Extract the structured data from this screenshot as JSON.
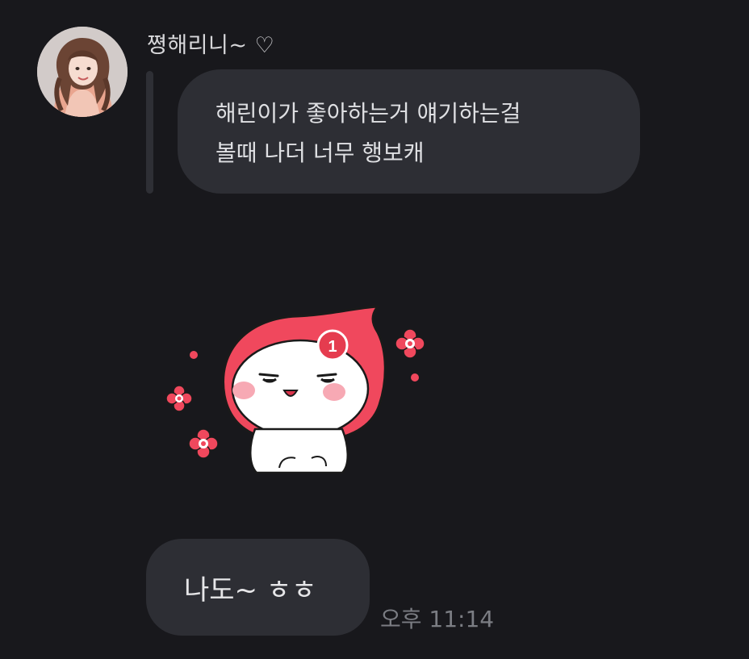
{
  "message_group": {
    "sender_name": "쪙해리니~ ♡",
    "avatar_icon": "profile-photo",
    "replied_message": {
      "lines": [
        "해린이가 좋아하는거 얘기하는걸",
        "볼때 나더 너무 행보캐"
      ]
    },
    "sticker": {
      "icon": "red-hood-character-sticker",
      "badge_count": "1"
    },
    "message": {
      "text": "나도~ ㅎㅎ",
      "time": "오후 11:14"
    }
  },
  "colors": {
    "background": "#18181c",
    "bubble": "#2d2e34",
    "sticker_red": "#f0485d",
    "timestamp": "#7b7d83"
  }
}
